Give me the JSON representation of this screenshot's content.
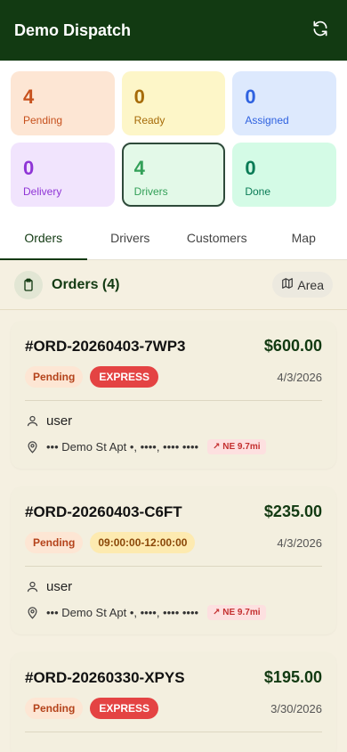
{
  "header": {
    "title": "Demo Dispatch",
    "refresh_icon": "refresh-icon"
  },
  "stats": [
    {
      "key": "pending",
      "value": "4",
      "label": "Pending",
      "color": "#c7511d"
    },
    {
      "key": "ready",
      "value": "0",
      "label": "Ready",
      "color": "#a66b08"
    },
    {
      "key": "assigned",
      "value": "0",
      "label": "Assigned",
      "color": "#2f62e0"
    },
    {
      "key": "delivery",
      "value": "0",
      "label": "Delivery",
      "color": "#8f35d6"
    },
    {
      "key": "drivers",
      "value": "4",
      "label": "Drivers",
      "color": "#33a058"
    },
    {
      "key": "done",
      "value": "0",
      "label": "Done",
      "color": "#0a7b56"
    }
  ],
  "tabs": [
    "Orders",
    "Drivers",
    "Customers",
    "Map"
  ],
  "active_tab": "Orders",
  "list": {
    "title": "Orders (4)",
    "area_label": "Area"
  },
  "orders": [
    {
      "id": "#ORD-20260403-7WP3",
      "price": "$600.00",
      "status": "Pending",
      "tag": "EXPRESS",
      "tag_type": "express",
      "date": "4/3/2026",
      "customer": "user",
      "address": "••• Demo St Apt •, ••••, •••• ••••",
      "distance": "↗ NE 9.7mi"
    },
    {
      "id": "#ORD-20260403-C6FT",
      "price": "$235.00",
      "status": "Pending",
      "tag": "09:00:00-12:00:00",
      "tag_type": "window",
      "date": "4/3/2026",
      "customer": "user",
      "address": "••• Demo St Apt •, ••••, •••• ••••",
      "distance": "↗ NE 9.7mi"
    },
    {
      "id": "#ORD-20260330-XPYS",
      "price": "$195.00",
      "status": "Pending",
      "tag": "EXPRESS",
      "tag_type": "express",
      "date": "3/30/2026"
    }
  ],
  "colors": {
    "header_bg": "#123a12",
    "accent": "#123a12",
    "express": "#e44343"
  }
}
